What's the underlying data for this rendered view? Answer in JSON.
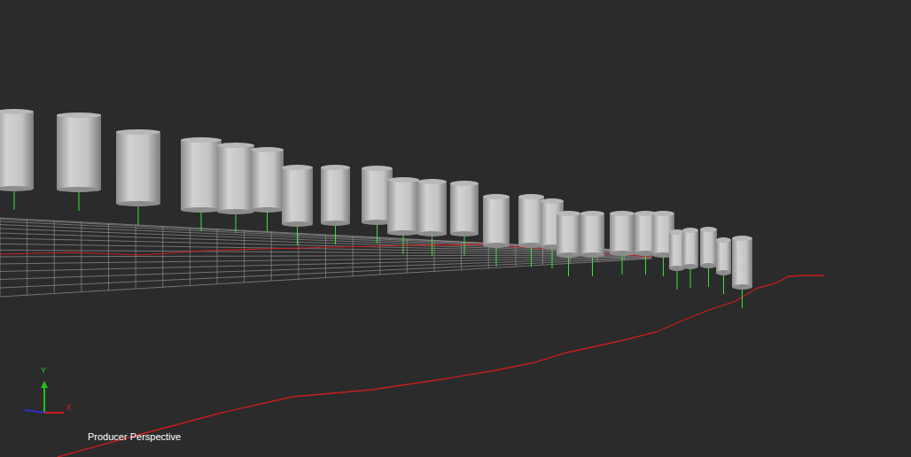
{
  "viewport": {
    "camera": "Producer Perspective"
  },
  "axes": [
    {
      "label": "Y",
      "color": "#1fc21f"
    },
    {
      "label": "X",
      "color": "#d01c1c"
    }
  ]
}
